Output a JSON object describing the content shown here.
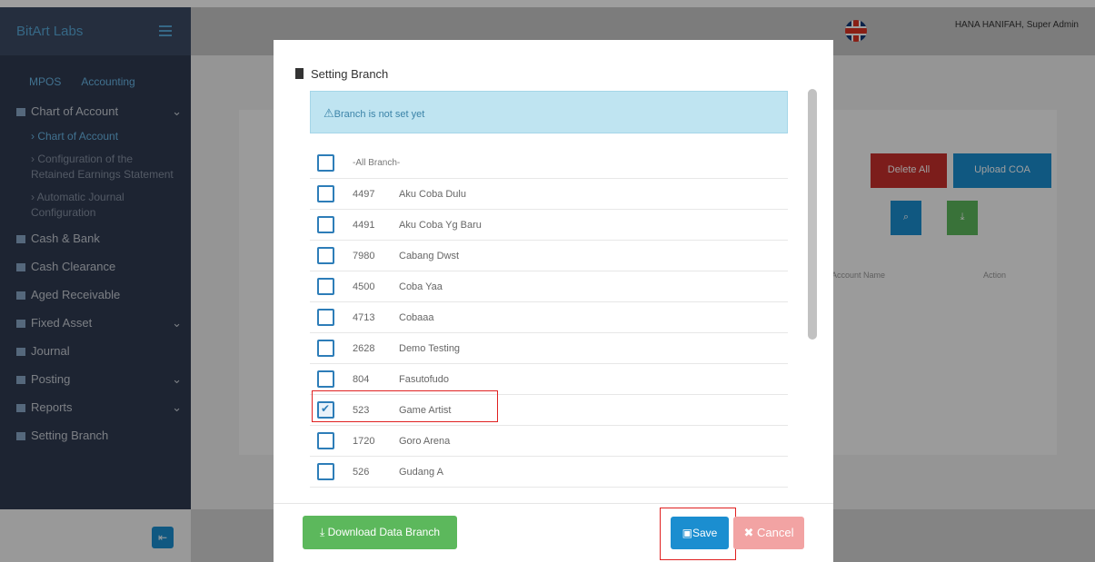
{
  "app": {
    "brand": "BitArt Labs",
    "user": "HANA HANIFAH, Super Admin"
  },
  "sidebar": {
    "tabs": [
      "MPOS",
      "Accounting"
    ],
    "items": [
      {
        "label": "Chart of Account",
        "icon": "table-icon",
        "chevron": "⌄"
      },
      {
        "label": "Cash & Bank",
        "icon": "table-icon"
      },
      {
        "label": "Cash Clearance",
        "icon": "table-icon"
      },
      {
        "label": "Aged Receivable",
        "icon": "table-icon"
      },
      {
        "label": "Fixed Asset",
        "icon": "table-icon",
        "chevron": "⌄"
      },
      {
        "label": "Journal",
        "icon": "book-icon"
      },
      {
        "label": "Posting",
        "icon": "check-icon",
        "chevron": "⌄"
      },
      {
        "label": "Reports",
        "icon": "chart-icon",
        "chevron": "⌄"
      },
      {
        "label": "Setting Branch",
        "icon": "gear-icon"
      }
    ],
    "sub_items": [
      {
        "label": "Chart of Account",
        "active": true
      },
      {
        "label": "Configuration of the Retained Earnings Statement"
      },
      {
        "label": "Automatic Journal Configuration"
      }
    ]
  },
  "background": {
    "buttons": {
      "delete_all": "Delete All",
      "upload_coa": "Upload COA"
    },
    "table_headers": {
      "account_name": "Account Name",
      "action": "Action"
    }
  },
  "modal": {
    "title": "Setting Branch",
    "alert": "Branch is not set yet",
    "all_branch": "-All Branch-",
    "branches": [
      {
        "code": "4497",
        "name": "Aku Coba Dulu",
        "checked": false
      },
      {
        "code": "4491",
        "name": "Aku Coba Yg Baru",
        "checked": false
      },
      {
        "code": "7980",
        "name": "Cabang Dwst",
        "checked": false
      },
      {
        "code": "4500",
        "name": "Coba Yaa",
        "checked": false
      },
      {
        "code": "4713",
        "name": "Cobaaa",
        "checked": false
      },
      {
        "code": "2628",
        "name": "Demo Testing",
        "checked": false
      },
      {
        "code": "804",
        "name": "Fasutofudo",
        "checked": false
      },
      {
        "code": "523",
        "name": "Game Artist",
        "checked": true
      },
      {
        "code": "1720",
        "name": "Goro Arena",
        "checked": false
      },
      {
        "code": "526",
        "name": "Gudang A",
        "checked": false
      }
    ],
    "buttons": {
      "download": "Download Data Branch",
      "save": "Save",
      "cancel": "Cancel"
    }
  },
  "colors": {
    "primary": "#1b8ed0",
    "success": "#5cb85c",
    "danger": "#f2a3a3",
    "highlight": "#e02020",
    "alert_bg": "#bfe4f1"
  }
}
